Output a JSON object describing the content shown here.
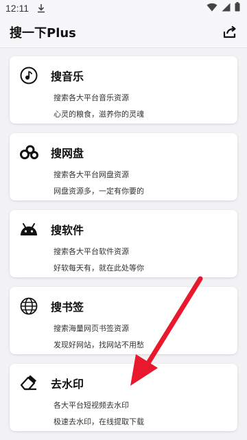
{
  "status_bar": {
    "time": "12:11"
  },
  "app_bar": {
    "title": "搜一下Plus"
  },
  "cards": [
    {
      "title": "搜音乐",
      "desc": "搜索各大平台音乐资源",
      "slogan": "心灵的粮食，滋养你的灵魂",
      "icon": "music-note-icon"
    },
    {
      "title": "搜网盘",
      "desc": "搜索各大平台网盘资源",
      "slogan": "网盘资源多，一定有你要的",
      "icon": "cloud-drive-icon"
    },
    {
      "title": "搜软件",
      "desc": "搜索各大平台软件资源",
      "slogan": "好软每天有，就在此处等你",
      "icon": "android-icon"
    },
    {
      "title": "搜书签",
      "desc": "搜索海量网页书签资源",
      "slogan": "发现好网站，找网站不用愁",
      "icon": "globe-icon"
    },
    {
      "title": "去水印",
      "desc": "各大平台短视频去水印",
      "slogan": "极速去水印，在线提取下载",
      "icon": "eraser-icon"
    }
  ],
  "colors": {
    "arrow": "#e8192c",
    "background": "#f2f2f4",
    "card": "#ffffff"
  }
}
